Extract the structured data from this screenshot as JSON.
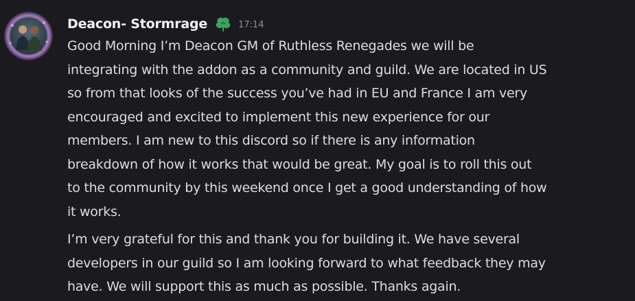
{
  "message": {
    "author": "Deacon- Stormrage",
    "role_icon": "green-leaf-icon",
    "timestamp": "17:14",
    "paragraphs": [
      {
        "lines": [
          "Good Morning I’m Deacon GM of Ruthless Renegades we will be",
          "integrating with the addon as a community and guild. We are located in US",
          "so from that looks of the success you’ve had in EU and France I am very",
          "encouraged and excited to implement this new experience for our",
          "members. I am new to this discord so if there is any information",
          "breakdown of how it works that would be great. My goal is to roll this out",
          "to the community by this weekend once I get a good understanding of how",
          "it works."
        ]
      },
      {
        "lines": [
          "I’m very grateful for this and thank you for building it. We have several",
          "developers in our guild so I am looking forward to what feedback they may",
          "have. We will support this as much as possible. Thanks again."
        ]
      }
    ]
  },
  "colors": {
    "background": "#1b1b1f",
    "username": "#f2f3f5",
    "text": "#dbdee1",
    "timestamp": "#8d9199",
    "role_icon": "#3ba55d"
  }
}
